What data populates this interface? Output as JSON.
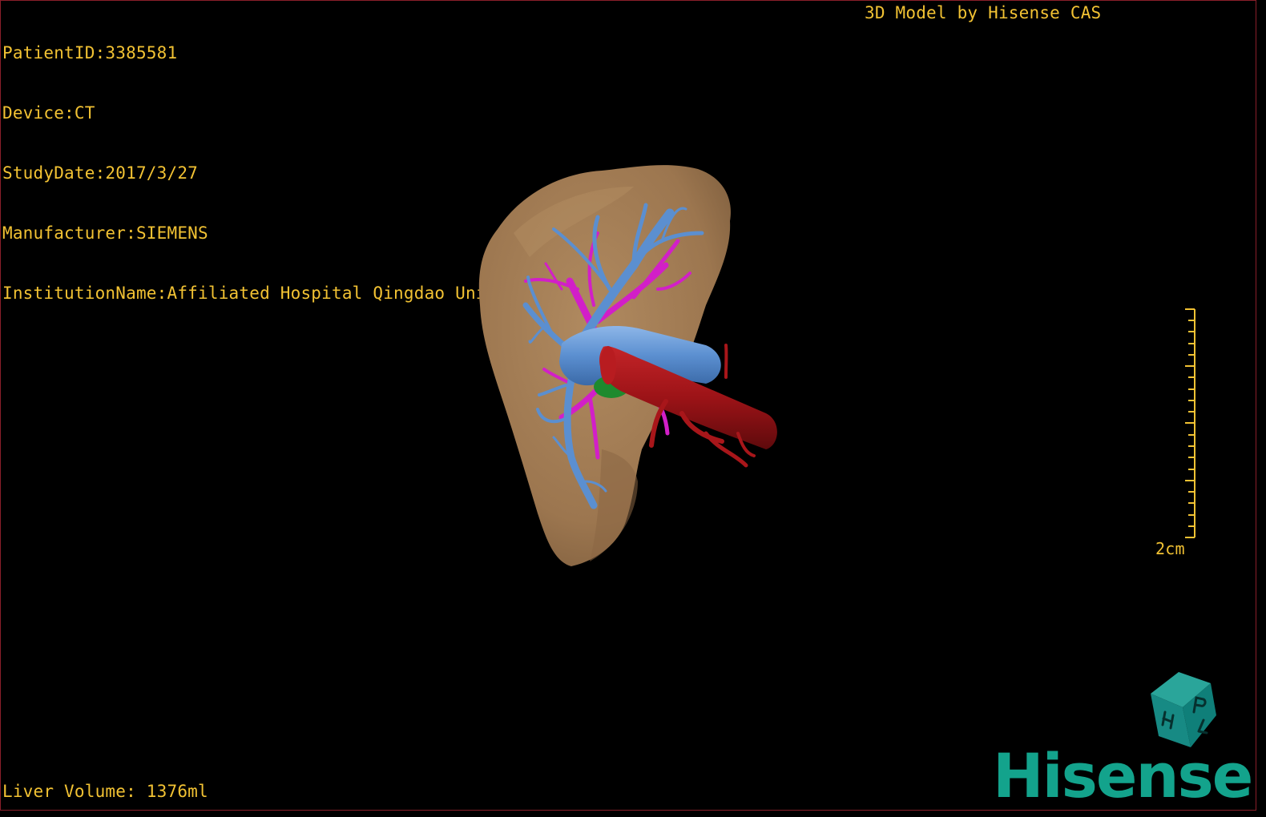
{
  "overlay": {
    "patient_id": "PatientID:3385581",
    "device": "Device:CT",
    "study_date": "StudyDate:2017/3/27",
    "manufacturer": "Manufacturer:SIEMENS",
    "institution": "InstitutionName:Affiliated Hospital Qingdao University-C",
    "watermark": "3D Model by Hisense CAS",
    "liver_volume": "Liver Volume: 1376ml"
  },
  "scale_bar": {
    "label": "2cm"
  },
  "orientation_cube": {
    "face_letters": [
      "P",
      "H",
      "L"
    ]
  },
  "logo": {
    "text": "Hisense"
  },
  "colors": {
    "overlay_text": "#f2c233",
    "liver": "#a07a52",
    "portal_vein": "#5b8fd0",
    "hepatic_artery_branches": "#d21fc8",
    "vena_cava": "#a8161a",
    "gallbladder": "#1e8a2e",
    "brand": "#13a38c",
    "viewport_border": "#8a1f2a"
  }
}
